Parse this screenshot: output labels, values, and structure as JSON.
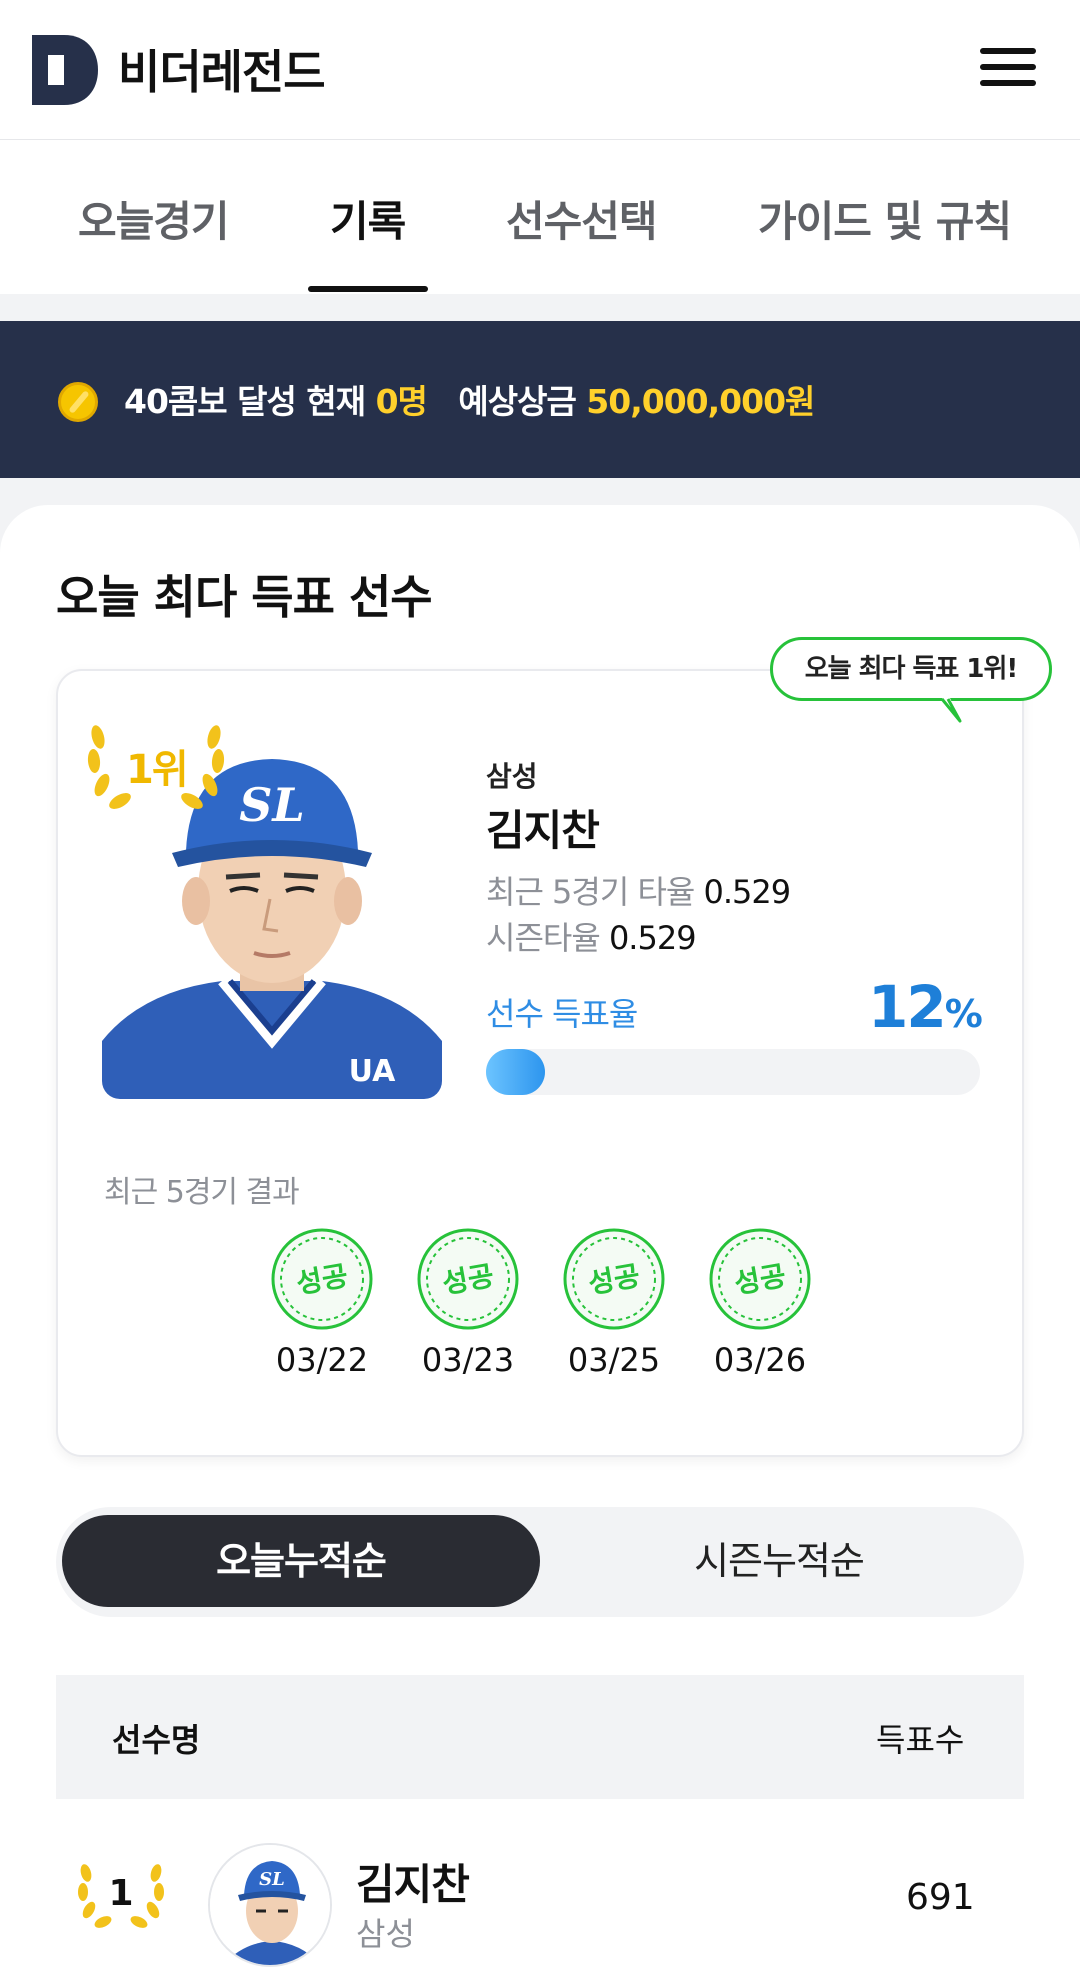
{
  "app": {
    "title": "비더레전드",
    "logo_letter": "D"
  },
  "nav": {
    "tabs": [
      {
        "label": "오늘경기",
        "active": false
      },
      {
        "label": "기록",
        "active": true
      },
      {
        "label": "선수선택",
        "active": false
      },
      {
        "label": "가이드 및 규칙",
        "active": false
      }
    ]
  },
  "banner": {
    "prefix": "40콤보 달성 현재 ",
    "count": "0명",
    "middle": "예상상금 ",
    "prize": "50,000,000원"
  },
  "top_voted": {
    "section_title": "오늘 최다 득표 선수",
    "bubble": "오늘 최다 득표 1위!",
    "rank_label": "1위",
    "player": {
      "team": "삼성",
      "name": "김지찬",
      "cap_logo": "SL",
      "recent_avg_label": "최근 5경기 타율",
      "recent_avg": "0.529",
      "season_avg_label": "시즌타율",
      "season_avg": "0.529",
      "vote_rate_label": "선수 득표율",
      "vote_rate": "12",
      "vote_rate_unit": "%"
    },
    "recent_results_label": "최근 5경기 결과",
    "recent_results": [
      {
        "result": "성공",
        "date": "03/22"
      },
      {
        "result": "성공",
        "date": "03/23"
      },
      {
        "result": "성공",
        "date": "03/25"
      },
      {
        "result": "성공",
        "date": "03/26"
      }
    ]
  },
  "sort_toggle": {
    "today": "오늘누적순",
    "season": "시즌누적순",
    "active": "today"
  },
  "ranking_table": {
    "col_player": "선수명",
    "col_votes": "득표수",
    "rows": [
      {
        "rank": "1",
        "name": "김지찬",
        "team": "삼성",
        "votes": "691"
      }
    ]
  },
  "colors": {
    "brand_navy": "#26304a",
    "highlight_yellow": "#ffd02b",
    "accent_blue": "#1e7fd8",
    "success_green": "#27c23a",
    "dark_toggle": "#2a2c33"
  }
}
